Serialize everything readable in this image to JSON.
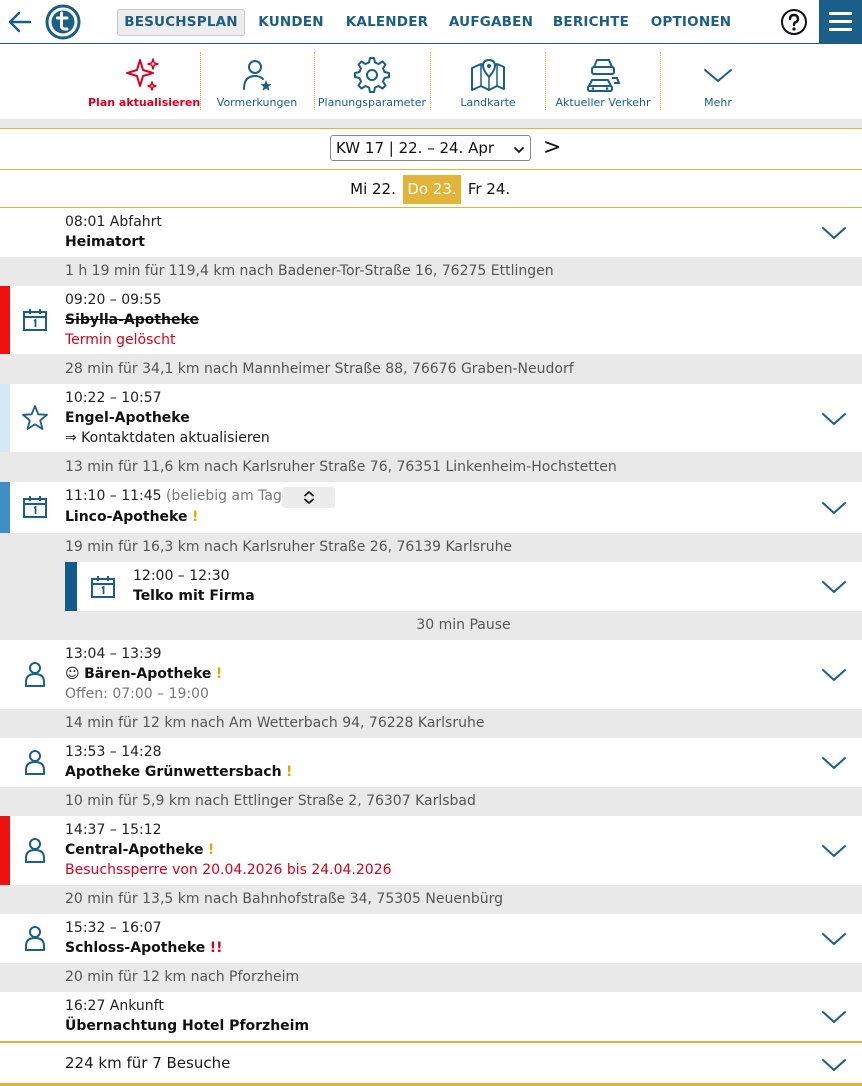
{
  "nav": {
    "tabs": [
      "BESUCHSPLAN",
      "KUNDEN",
      "KALENDER",
      "AUFGABEN",
      "BERICHTE",
      "OPTIONEN"
    ]
  },
  "toolbar": {
    "items": [
      "Plan aktualisieren",
      "Vormerkungen",
      "Planungsparameter",
      "Landkarte",
      "Aktueller Verkehr",
      "Mehr"
    ]
  },
  "week": {
    "selected": "KW 17 | 22. – 24. Apr",
    "next": ">"
  },
  "days": [
    "Mi 22.",
    "Do 23.",
    "Fr 24."
  ],
  "colors": {
    "brand": "#1b5e87",
    "accent": "#e3b43a",
    "alert": "#d8001c"
  },
  "start": {
    "time": "08:01 Abfahrt",
    "name": "Heimatort"
  },
  "travels": [
    "1 h 19 min für 119,4 km nach Badener-Tor-Straße 16, 76275 Ettlingen",
    "28 min für 34,1 km nach Mannheimer Straße 88, 76676 Graben-Neudorf",
    "13 min für 11,6 km nach Karlsruher Straße 76, 76351 Linkenheim-Hochstetten",
    "19 min für 16,3 km nach Karlsruher Straße 26, 76139 Karlsruhe",
    "14 min für 12 km nach Am Wetterbach 94, 76228 Karlsruhe",
    "10 min für 5,9 km nach Ettlinger Straße 2, 76307 Karlsbad",
    "20 min für 13,5 km nach Bahnhofstraße 34, 75305 Neuenbürg",
    "20 min für 12 km nach Pforzheim"
  ],
  "visits": {
    "sibylla": {
      "time": "09:20 – 09:55",
      "name": "Sibylla-Apotheke",
      "note": "Termin gelöscht"
    },
    "engel": {
      "time": "10:22 – 10:57",
      "name": "Engel-Apotheke",
      "note": "⇒ Kontaktdaten aktualisieren"
    },
    "linco": {
      "time": "11:10 – 11:45",
      "time_note": "(beliebig am Tag)",
      "name": "Linco-Apotheke",
      "flag": "!"
    },
    "telko": {
      "time": "12:00 – 12:30",
      "name": "Telko mit Firma"
    },
    "pause": "30 min Pause",
    "baeren": {
      "time": "13:04 – 13:39",
      "smiley": "☺",
      "name": "Bären-Apotheke",
      "flag": "!",
      "note": "Offen: 07:00 – 19:00"
    },
    "gruen": {
      "time": "13:53 – 14:28",
      "name": "Apotheke Grünwettersbach",
      "flag": "!"
    },
    "central": {
      "time": "14:37 – 15:12",
      "name": "Central-Apotheke",
      "flag": "!",
      "note": "Besuchssperre von 20.04.2026 bis 24.04.2026"
    },
    "schloss": {
      "time": "15:32 – 16:07",
      "name": "Schloss-Apotheke",
      "flag": "!!"
    }
  },
  "end": {
    "time": "16:27 Ankunft",
    "name": "Übernachtung Hotel Pforzheim"
  },
  "summary": "224 km für 7 Besuche"
}
